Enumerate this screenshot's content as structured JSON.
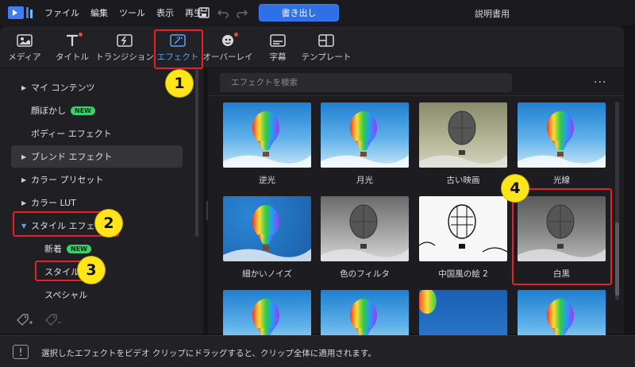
{
  "menu": {
    "items": [
      "ファイル",
      "編集",
      "ツール",
      "表示",
      "再生"
    ],
    "export_label": "書き出し",
    "doc_title": "説明書用"
  },
  "tabs": [
    {
      "label": "メディア",
      "icon": "media-icon",
      "dot": false,
      "active": false
    },
    {
      "label": "タイトル",
      "icon": "title-icon",
      "dot": true,
      "active": false
    },
    {
      "label": "トランジション",
      "icon": "transition-icon",
      "dot": false,
      "active": false
    },
    {
      "label": "エフェクト",
      "icon": "effect-icon",
      "dot": false,
      "active": true
    },
    {
      "label": "オーバーレイ",
      "icon": "overlay-icon",
      "dot": true,
      "active": false
    },
    {
      "label": "字幕",
      "icon": "subtitle-icon",
      "dot": false,
      "active": false
    },
    {
      "label": "テンプレート",
      "icon": "template-icon",
      "dot": false,
      "active": false
    }
  ],
  "sidebar": {
    "items": [
      {
        "label": "マイ コンテンツ",
        "caret": "▶"
      },
      {
        "label": "顔ぼかし",
        "badge": "NEW"
      },
      {
        "label": "ボディー エフェクト"
      },
      {
        "label": "ブレンド エフェクト",
        "caret": "▶"
      },
      {
        "label": "カラー プリセット",
        "caret": "▶"
      },
      {
        "label": "カラー LUT",
        "caret": "▶"
      },
      {
        "label": "スタイル エフェクト",
        "caret": "▼"
      },
      {
        "label": "新着",
        "badge": "NEW"
      },
      {
        "label": "スタイル"
      },
      {
        "label": "スペシャル"
      }
    ]
  },
  "search": {
    "placeholder": "エフェクトを検索"
  },
  "effects": [
    {
      "label": "逆光",
      "style": "sky"
    },
    {
      "label": "月光",
      "style": "sky"
    },
    {
      "label": "古い映画",
      "style": "oldfilm"
    },
    {
      "label": "光線",
      "style": "sky"
    },
    {
      "label": "細かいノイズ",
      "style": "noise"
    },
    {
      "label": "色のフィルタ",
      "style": "gray"
    },
    {
      "label": "中国風の絵 2",
      "style": "ink"
    },
    {
      "label": "白黒",
      "style": "mono"
    },
    {
      "label": "",
      "style": "sky"
    },
    {
      "label": "",
      "style": "sky"
    },
    {
      "label": "",
      "style": "deepblue"
    },
    {
      "label": "",
      "style": "sky"
    }
  ],
  "status": {
    "text": "選択したエフェクトをビデオ クリップにドラッグすると、クリップ全体に適用されます。"
  },
  "callouts": [
    "1",
    "2",
    "3",
    "4"
  ],
  "colors": {
    "accent": "#2f6fe8",
    "annotation_red": "#e8202a",
    "callout_yellow": "#ffe51a",
    "new_badge": "#3ccf6a"
  }
}
